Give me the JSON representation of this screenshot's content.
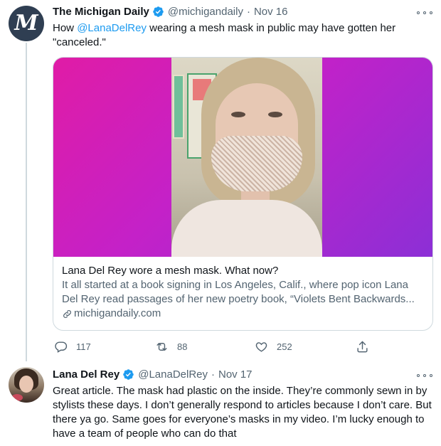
{
  "tweet1": {
    "name": "The Michigan Daily",
    "avatar_letter": "M",
    "handle": "@michigandaily",
    "separator": "·",
    "time": "Nov 16",
    "text_before": "How ",
    "mention": "@LanaDelRey",
    "text_after": " wearing a mesh mask in public may have gotten her \"canceled.\"",
    "card": {
      "title": "Lana Del Rey wore a mesh mask. What now?",
      "description": "It all started at a book signing in Los Angeles, Calif., where pop icon Lana Del Rey read passages of her new poetry book, “Violets Bent Backwards...",
      "domain": "michigandaily.com"
    },
    "actions": {
      "replies": "117",
      "retweets": "88",
      "likes": "252"
    }
  },
  "tweet2": {
    "name": "Lana Del Rey",
    "handle": "@LanaDelRey",
    "separator": "·",
    "time": "Nov 17",
    "text": "Great article. The mask had plastic on the inside. They’re commonly sewn in by stylists these days. I don’t generally respond to articles because I don’t care. But there ya go. Same goes for everyone’s masks in my video. I’m lucky enough to have a team of people who can do that"
  },
  "colors": {
    "accent": "#1d9bf0",
    "secondary_text": "#536471",
    "border": "#cfd9de"
  }
}
